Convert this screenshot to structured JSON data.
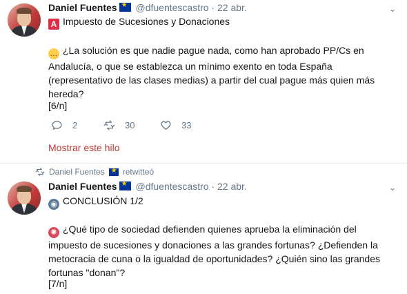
{
  "tweets": [
    {
      "author_name": "Daniel Fuentes",
      "handle": "@dfuentescastro",
      "separator": "·",
      "date": "22 abr.",
      "topic_icon": "A",
      "topic": "Impuesto de Sucesiones y Donaciones",
      "body": "¿La solución es que nadie pague nada, como han aprobado PP/Cs en Andalucía, o que se establezca un mínimo exento en toda España (representativo de las clases medias) a partir del cual pague más quien más hereda?",
      "counter": "[6/n]",
      "replies": "2",
      "retweets": "30",
      "likes": "33",
      "show_thread": "Mostrar este hilo"
    },
    {
      "retweeted_by": "Daniel Fuentes",
      "retweet_label": "retwitteó",
      "author_name": "Daniel Fuentes",
      "handle": "@dfuentescastro",
      "separator": "·",
      "date": "22 abr.",
      "heading": "CONCLUSIÓN 1/2",
      "body": "¿Qué tipo de sociedad defienden quienes aprueba la eliminación del impuesto de sucesiones y donaciones a las grandes fortunas? ¿Defienden la metocracia de cuna o la igualdad de oportunidades? ¿Quién sino las grandes fortunas \"donan\"?",
      "counter": "[7/n]"
    }
  ],
  "icons": {
    "verified_flag": "eu-flag-icon",
    "reply": "reply-icon",
    "retweet": "retweet-icon",
    "like": "heart-icon",
    "menu": "chevron-down-icon"
  },
  "colors": {
    "link": "#c03535",
    "muted": "#657786",
    "text": "#14171a"
  }
}
